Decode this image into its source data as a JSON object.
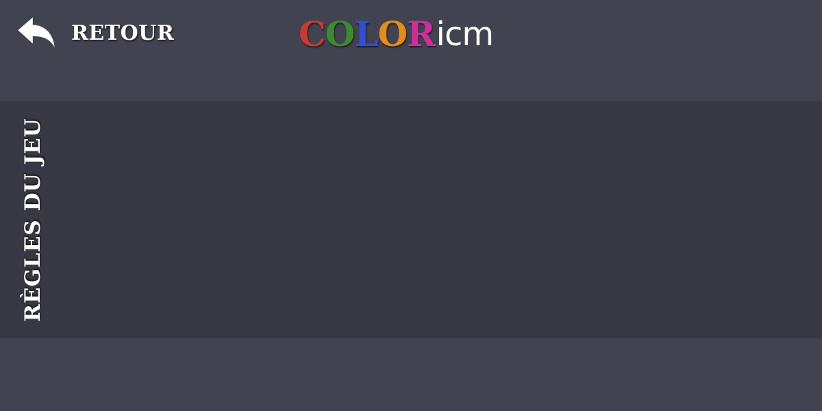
{
  "header": {
    "back_label": "RETOUR",
    "back_icon": "reply-arrow-icon",
    "logo": {
      "letters": [
        {
          "char": "C",
          "color": "#c63a32"
        },
        {
          "char": "O",
          "color": "#3f8a2e"
        },
        {
          "char": "L",
          "color": "#2f4fd8"
        },
        {
          "char": "O",
          "color": "#e38c1e"
        },
        {
          "char": "R",
          "color": "#cc2f9a"
        }
      ],
      "suffix": "icm"
    }
  },
  "main": {
    "section_title": "RÈGLES DU JEU"
  },
  "colors": {
    "background": "#424350",
    "band": "#383844",
    "text": "#ffffff"
  }
}
